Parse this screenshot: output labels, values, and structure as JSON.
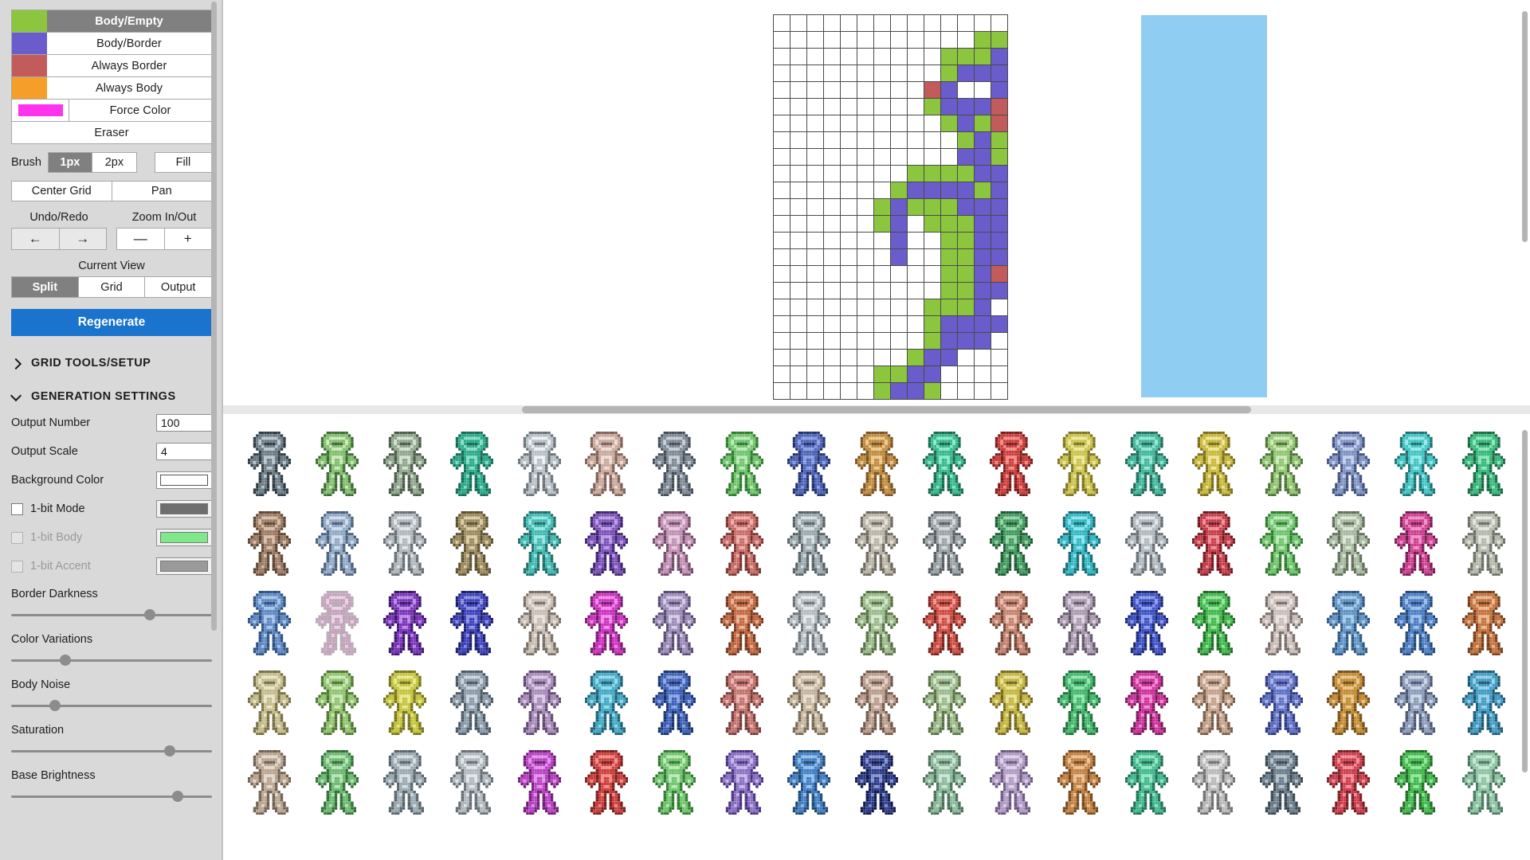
{
  "palette": {
    "rows": [
      {
        "label": "Body/Empty",
        "color": "#8cc63e",
        "active": true,
        "type": "swatch"
      },
      {
        "label": "Body/Border",
        "color": "#6a5ccb",
        "active": false,
        "type": "swatch"
      },
      {
        "label": "Always Border",
        "color": "#c25b5b",
        "active": false,
        "type": "swatch"
      },
      {
        "label": "Always Body",
        "color": "#f59f28",
        "active": false,
        "type": "swatch"
      },
      {
        "label": "Force Color",
        "color": "#ff33ee",
        "active": false,
        "type": "chip"
      },
      {
        "label": "Eraser",
        "color": "",
        "active": false,
        "type": "none"
      }
    ]
  },
  "tools": {
    "brush_label": "Brush",
    "brush_options": [
      "1px",
      "2px"
    ],
    "brush_selected": "1px",
    "fill_label": "Fill",
    "center_grid_label": "Center Grid",
    "pan_label": "Pan",
    "undo_redo_label": "Undo/Redo",
    "undo_icon": "arrow-left-icon",
    "redo_icon": "arrow-right-icon",
    "undo_glyph": "←",
    "redo_glyph": "→",
    "zoom_label": "Zoom In/Out",
    "zoom_out_glyph": "—",
    "zoom_in_glyph": "+",
    "current_view_label": "Current View",
    "view_options": [
      "Split",
      "Grid",
      "Output"
    ],
    "view_selected": "Split",
    "regenerate_label": "Regenerate"
  },
  "sections": {
    "grid_tools": {
      "title": "GRID TOOLS/SETUP",
      "expanded": false,
      "icon": "chevron-right-icon"
    },
    "generation": {
      "title": "GENERATION SETTINGS",
      "expanded": true,
      "icon": "chevron-down-icon"
    }
  },
  "settings": {
    "output_number": {
      "label": "Output Number",
      "value": "100"
    },
    "output_scale": {
      "label": "Output Scale",
      "value": "4"
    },
    "background_color": {
      "label": "Background Color",
      "value": "#ffffff"
    },
    "one_bit_mode": {
      "label": "1-bit Mode",
      "checked": false,
      "disabled": false,
      "color": "#6e6e6e"
    },
    "one_bit_body": {
      "label": "1-bit Body",
      "checked": false,
      "disabled": true,
      "color": "#7ee88a"
    },
    "one_bit_accent": {
      "label": "1-bit Accent",
      "checked": false,
      "disabled": true,
      "color": "#9a9a9a"
    },
    "sliders": [
      {
        "label": "Border Darkness",
        "percent": 69
      },
      {
        "label": "Color Variations",
        "percent": 27
      },
      {
        "label": "Body Noise",
        "percent": 22
      },
      {
        "label": "Saturation",
        "percent": 79
      },
      {
        "label": "Base Brightness",
        "percent": 83
      }
    ]
  },
  "canvas": {
    "cols": 14,
    "rows": 23,
    "preview_color": "#8fcdf2",
    "colors": {
      "e": "#ffffff",
      "g": "#8cc63e",
      "p": "#6a5ccb",
      "r": "#c25b5b"
    },
    "pixels": [
      "eeeeeeeeeeeeee",
      "eeeeeeeeeeeegg",
      "eeeeeeeeeegggp",
      "eeeeeeeeeegppp",
      "eeeeeeeeerpeep",
      "eeeeeeeeegpppr",
      "eeeeeeeeeegpgr",
      "eeeeeeeeeeegpg",
      "eeeeeeeeeeeppg",
      "eeeeeeeeggggpp",
      "eeeeeeegppppgp",
      "eeeeeegpgggppp",
      "eeeeeegpegggpp",
      "eeeeeeepeeggpp",
      "eeeeeeepeeggpp",
      "eeeeeeeeeeggpr",
      "eeeeeeeeeeggpp",
      "eeeeeeeeegggpe",
      "eeeeeeeeegppppe",
      "eeeeeeeeegpppe",
      "eeeeeeeegppeee",
      "eeeeeeggppeeee",
      "eeeeeegppgeeee"
    ]
  },
  "gallery": {
    "columns": 19,
    "rows_visible": 5,
    "sprites": [
      [
        "#6d7b85",
        "#b9c6cd",
        "#2f3b44"
      ],
      [
        "#7fbf6a",
        "#cde8bb",
        "#3d6b33"
      ],
      [
        "#8fa58d",
        "#d3e0cf",
        "#4a5a48"
      ],
      [
        "#2aa98a",
        "#7fe0c4",
        "#136b55"
      ],
      [
        "#b8c0c5",
        "#edf2f5",
        "#6a7379"
      ],
      [
        "#c9a79a",
        "#eedcd4",
        "#7d6158"
      ],
      [
        "#7d8894",
        "#c4ccd4",
        "#454e57"
      ],
      [
        "#6ec46b",
        "#b9e9b6",
        "#2f7b2d"
      ],
      [
        "#4a63b8",
        "#8a9ce0",
        "#23326e"
      ],
      [
        "#c08a3c",
        "#edc989",
        "#7a5420"
      ],
      [
        "#33b88c",
        "#8ae8c6",
        "#186a4f"
      ],
      [
        "#cc3b38",
        "#f08b88",
        "#7c1d1b"
      ],
      [
        "#ccc24a",
        "#eee89b",
        "#7d7620"
      ],
      [
        "#3fb69a",
        "#92e5d3",
        "#1d6d5b"
      ],
      [
        "#c8b838",
        "#eee49a",
        "#7b6f18"
      ],
      [
        "#8fc56e",
        "#cfe9ba",
        "#4d7238"
      ],
      [
        "#7d92c4",
        "#c3cee8",
        "#41517d"
      ],
      [
        "#3fc4c4",
        "#96e8e8",
        "#1c7272"
      ],
      [
        "#34b87a",
        "#8ce5b6",
        "#176b43"
      ],
      [
        "#9c7a63",
        "#d6bca9",
        "#5c4533"
      ],
      [
        "#8fa8c6",
        "#cfdbe8",
        "#4a5f7a"
      ],
      [
        "#b0b6bb",
        "#e2e6e9",
        "#666d73"
      ],
      [
        "#9c8a5c",
        "#d8cda8",
        "#5b5030"
      ],
      [
        "#3fb9b2",
        "#93e5e1",
        "#1d6f6a"
      ],
      [
        "#7a4fb8",
        "#b79ae0",
        "#3d226e"
      ],
      [
        "#c08fb5",
        "#e6c9de",
        "#734a68"
      ],
      [
        "#c86a66",
        "#eeaca9",
        "#7b3330"
      ],
      [
        "#9aa8ad",
        "#d4dde0",
        "#576267"
      ],
      [
        "#b8b3a6",
        "#e4e1da",
        "#6e695d"
      ],
      [
        "#9aa2a6",
        "#d4d9db",
        "#575d60"
      ],
      [
        "#3f9a5c",
        "#92d3a8",
        "#1d5a32"
      ],
      [
        "#2fb8c4",
        "#8ce4ec",
        "#156b74"
      ],
      [
        "#b0b8bd",
        "#e2e6e9",
        "#666d73"
      ],
      [
        "#c43b47",
        "#ee8b94",
        "#76181f"
      ],
      [
        "#6ec46b",
        "#b9e9b6",
        "#2f7b2d"
      ],
      [
        "#a8b8a0",
        "#dce6d8",
        "#5f6f58"
      ],
      [
        "#cc3d8f",
        "#f08cc3",
        "#7a1a53"
      ],
      [
        "#b3b8ab",
        "#e3e6df",
        "#6a6e63"
      ],
      [
        "#5c87c4",
        "#a6c3e6",
        "#2e5080"
      ],
      [
        "#c4a0bb",
        "#e8d2e2",
        "#76587080"
      ],
      [
        "#7a2fb8",
        "#b78ae0",
        "#3d1570"
      ],
      [
        "#3a3fb8",
        "#8a8ce0",
        "#1b1d70"
      ],
      [
        "#c8bdb3",
        "#e9e2dc",
        "#776d64"
      ],
      [
        "#cc2fbf",
        "#f08ae8",
        "#7a1873"
      ],
      [
        "#9a8ab8",
        "#d3cbe4",
        "#584a70"
      ],
      [
        "#c4663f",
        "#e8b093",
        "#76381d"
      ],
      [
        "#b5bcc0",
        "#e4e8ea",
        "#6b7277"
      ],
      [
        "#9ab88a",
        "#d4e6cb",
        "#587044"
      ],
      [
        "#cc4a40",
        "#f0948d",
        "#7a231c"
      ],
      [
        "#c4806b",
        "#e8c0b2",
        "#764436"
      ],
      [
        "#ab9ab0",
        "#dcd3e0",
        "#635868"
      ],
      [
        "#3a4fc4",
        "#8a9ae8",
        "#1b2776"
      ],
      [
        "#3fb84a",
        "#92e49a",
        "#1d6f24"
      ],
      [
        "#c9bdb8",
        "#eae3e0",
        "#786c67"
      ],
      [
        "#5c92c4",
        "#a6cae6",
        "#2e5680"
      ],
      [
        "#4a7dc4",
        "#99bde6",
        "#23497c"
      ],
      [
        "#c4703a",
        "#e8b68e",
        "#763f19"
      ],
      [
        "#c4bb8a",
        "#e8e3cb",
        "#766f44"
      ],
      [
        "#8fc46b",
        "#cde8b9",
        "#4d7630"
      ],
      [
        "#c4c43a",
        "#e8e88a",
        "#767618"
      ],
      [
        "#8a9aa8",
        "#cbd5dd",
        "#4a5763"
      ],
      [
        "#a88ab8",
        "#d9cbe4",
        "#604a70"
      ],
      [
        "#3fa8c4",
        "#92d9e8",
        "#1d6076"
      ],
      [
        "#3a5fb8",
        "#8aa3e0",
        "#1b3370"
      ],
      [
        "#c4706b",
        "#e8b4b1",
        "#763c38"
      ],
      [
        "#c4b39a",
        "#e8ded3",
        "#766954"
      ],
      [
        "#b89a8a",
        "#e4d3cb",
        "#70584a"
      ],
      [
        "#9ab88a",
        "#d4e6cb",
        "#587044"
      ],
      [
        "#c4b53f",
        "#e8e292",
        "#76691d"
      ],
      [
        "#3fb86b",
        "#92e4b1",
        "#1d7038"
      ],
      [
        "#cc2f9a",
        "#f08ad3",
        "#7a1859"
      ],
      [
        "#c4a08a",
        "#e8d6cb",
        "#765c44"
      ],
      [
        "#5c6ec4",
        "#a6b2e6",
        "#2e3a80"
      ],
      [
        "#c48a2f",
        "#e8c48a",
        "#765018"
      ],
      [
        "#8a9ab8",
        "#cbd5e4",
        "#4a5770"
      ],
      [
        "#3f9ac4",
        "#92cfe8",
        "#1d5a76"
      ],
      [
        "#b8a48f",
        "#e4d8cd",
        "#706050"
      ],
      [
        "#6ab86e",
        "#b6e4b8",
        "#2e7032"
      ],
      [
        "#9aa8b0",
        "#d4dde2",
        "#57646c"
      ],
      [
        "#b0b8bd",
        "#e2e6e9",
        "#666d73"
      ],
      [
        "#b83fc4",
        "#e092e8",
        "#701d76"
      ],
      [
        "#cc3b38",
        "#f08b88",
        "#7c1d1b"
      ],
      [
        "#6ec46b",
        "#b9e9b6",
        "#2f7b2d"
      ],
      [
        "#8a6ec4",
        "#c3b6e6",
        "#4a3480"
      ],
      [
        "#3f7dc4",
        "#92bfe8",
        "#1d4976"
      ],
      [
        "#2a3a8a",
        "#8292c8",
        "#121a4c"
      ],
      [
        "#8ab89a",
        "#cbe4d4",
        "#4a7058"
      ],
      [
        "#b09ac4",
        "#ded3e6",
        "#6c5880"
      ],
      [
        "#c4803f",
        "#e8c092",
        "#76481d"
      ],
      [
        "#3fb88a",
        "#92e4c6",
        "#1d7057"
      ],
      [
        "#b8b8b8",
        "#e4e4e4",
        "#707070"
      ],
      [
        "#6a7b8a",
        "#b2c0cb",
        "#3a4750"
      ],
      [
        "#cc3b4a",
        "#f08b96",
        "#7c1d24"
      ],
      [
        "#3fb84a",
        "#92e49a",
        "#1d6f24"
      ],
      [
        "#8ac4a0",
        "#cbe8d6",
        "#4a7660"
      ]
    ]
  }
}
